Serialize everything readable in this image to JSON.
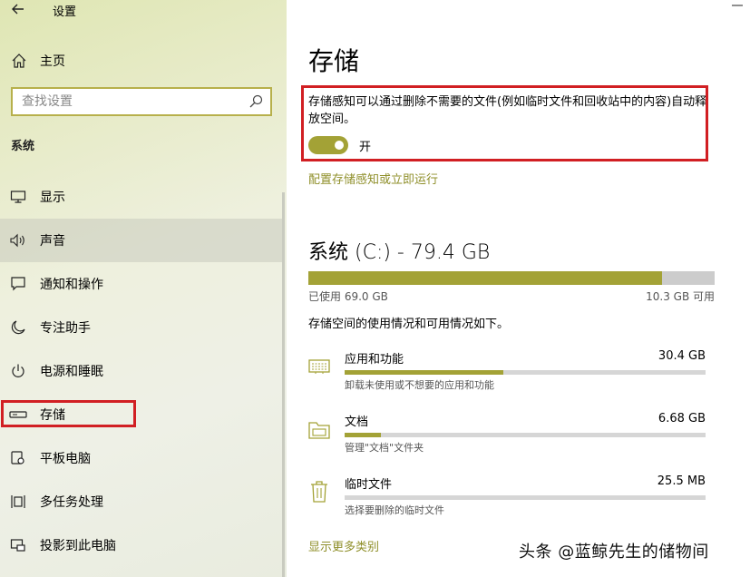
{
  "app": {
    "title": "设置"
  },
  "sidebar": {
    "home_label": "主页",
    "search_placeholder": "查找设置",
    "section_label": "系统",
    "items": [
      {
        "label": "显示",
        "icon": "monitor-icon"
      },
      {
        "label": "声音",
        "icon": "speaker-icon"
      },
      {
        "label": "通知和操作",
        "icon": "notification-icon"
      },
      {
        "label": "专注助手",
        "icon": "moon-icon"
      },
      {
        "label": "电源和睡眠",
        "icon": "power-icon"
      },
      {
        "label": "存储",
        "icon": "storage-icon"
      },
      {
        "label": "平板电脑",
        "icon": "tablet-icon"
      },
      {
        "label": "多任务处理",
        "icon": "multitask-icon"
      },
      {
        "label": "投影到此电脑",
        "icon": "project-icon"
      }
    ],
    "selected_index": 5,
    "hover_index": 1
  },
  "main": {
    "title": "存储",
    "storage_sense": {
      "description": "存储感知可以通过删除不需要的文件(例如临时文件和回收站中的内容)自动释放空间。",
      "toggle_on": true,
      "toggle_state": "开",
      "configure_link": "配置存储感知或立即运行"
    },
    "drive": {
      "title": "系统 (C:) - 79.4 GB",
      "used_fraction": 0.87,
      "used_text": "已使用 69.0 GB",
      "free_text": "10.3 GB 可用",
      "usage_description": "存储空间的使用情况和可用情况如下。"
    },
    "categories": [
      {
        "name": "应用和功能",
        "size": "30.4 GB",
        "fraction": 0.44,
        "description": "卸载未使用或不想要的应用和功能",
        "icon": "apps-icon"
      },
      {
        "name": "文档",
        "size": "6.68 GB",
        "fraction": 0.1,
        "description": "管理\"文档\"文件夹",
        "icon": "folder-icon"
      },
      {
        "name": "临时文件",
        "size": "25.5 MB",
        "fraction": 0.0,
        "description": "选择要删除的临时文件",
        "icon": "trash-icon"
      }
    ],
    "more_link": "显示更多类别"
  },
  "watermark": "头条 @蓝鲸先生的储物间",
  "colors": {
    "accent": "#a3a236",
    "link": "#8f8f2a",
    "highlight": "#d11f23"
  }
}
